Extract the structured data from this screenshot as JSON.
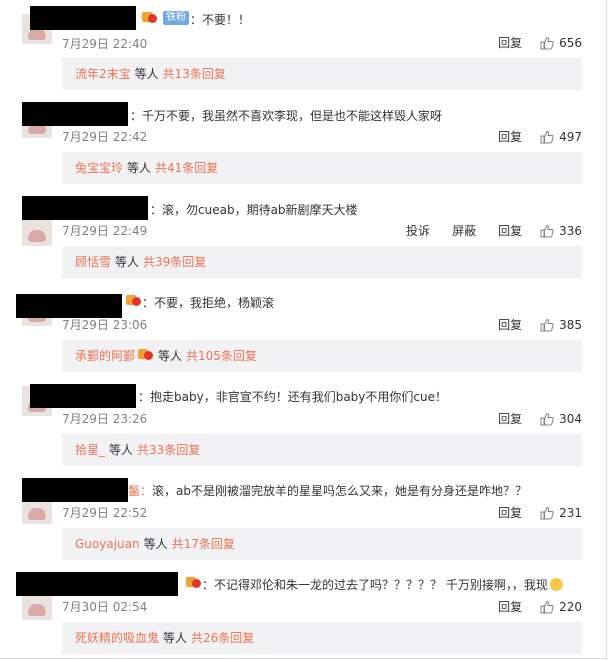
{
  "ui": {
    "reply_label": "回复",
    "report_label": "投诉",
    "block_label": "屏蔽",
    "others_label": "等人",
    "accent": "#eb7350"
  },
  "comments": [
    {
      "prefix": "",
      "text": "：不要！！",
      "badge": "铁粉",
      "date": "7月29日 22:40",
      "likes": "656",
      "reply_name": "流年2末宝",
      "reply_count": "共13条回复"
    },
    {
      "prefix": "：",
      "text": "千万不要，我虽然不喜欢李现，但是也不能这样毁人家呀",
      "date": "7月29日 22:42",
      "likes": "497",
      "reply_name": "兔宝宝玲",
      "reply_count": "共41条回复"
    },
    {
      "prefix": "：",
      "text": "滚，勿cueab，期待ab新剧摩天大楼",
      "date": "7月29日 22:49",
      "likes": "336",
      "reply_name": "顾恬雪",
      "reply_count": "共39条回复"
    },
    {
      "prefix": "",
      "text": "：不要，我拒绝，杨颖滚",
      "date": "7月29日 23:06",
      "likes": "385",
      "reply_name": "承鄞的阿鄞",
      "reply_count": "共105条回复"
    },
    {
      "prefix": "：",
      "text": "抱走baby，非官宣不约！还有我们baby不用你们cue！",
      "date": "7月29日 23:26",
      "likes": "304",
      "reply_name": "拾星_",
      "reply_count": "共33条回复"
    },
    {
      "prefix": "鬣：",
      "text": "滚，ab不是刚被溜完放羊的星星吗怎么又来，她是有分身还是咋地？？",
      "date": "7月29日 22:52",
      "likes": "231",
      "reply_name": "Guoyajuan",
      "reply_count": "共17条回复"
    },
    {
      "prefix": "",
      "text": "：不记得邓伦和朱一龙的过去了吗？？？？？ 千万别接啊，，我现",
      "date": "7月30日 02:54",
      "likes": "220",
      "reply_name": "死妖精的吸血鬼",
      "reply_count": "共26条回复"
    }
  ]
}
